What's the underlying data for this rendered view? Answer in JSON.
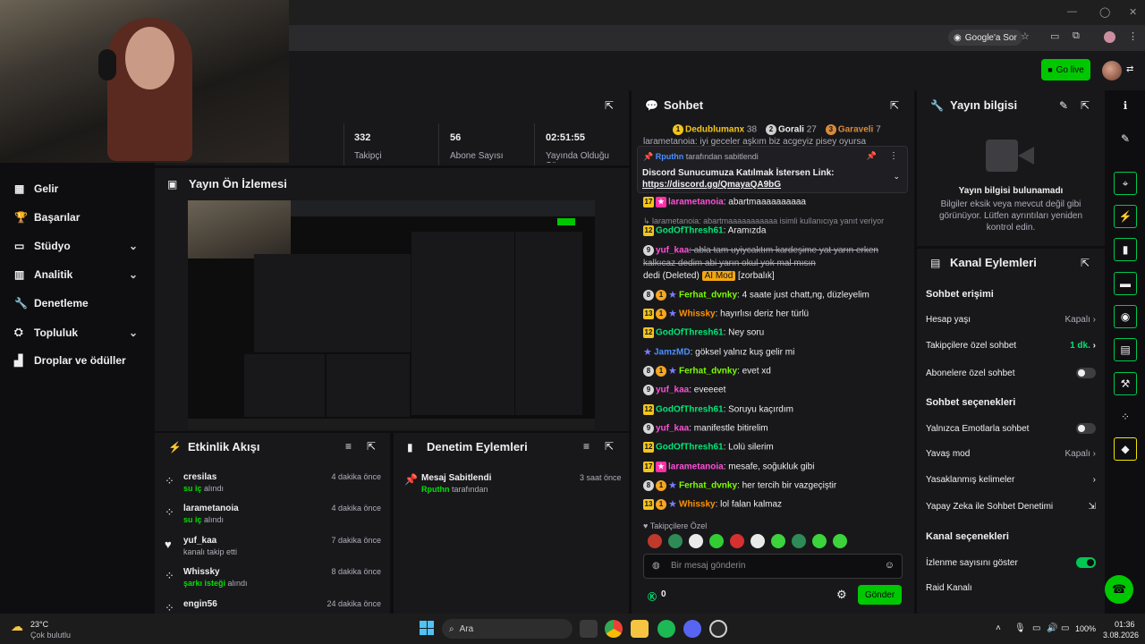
{
  "browser": {
    "google_ask": "Google'a Sor"
  },
  "header": {
    "go_live": "Go live"
  },
  "nav": {
    "items": [
      {
        "label": "Gelir",
        "icon": "dollar-icon",
        "chevron": false
      },
      {
        "label": "Başarılar",
        "icon": "trophy-icon",
        "chevron": false
      },
      {
        "label": "Stüdyo",
        "icon": "studio-icon",
        "chevron": true
      },
      {
        "label": "Analitik",
        "icon": "chart-icon",
        "chevron": true
      },
      {
        "label": "Denetleme",
        "icon": "wrench-icon",
        "chevron": false
      },
      {
        "label": "Topluluk",
        "icon": "community-icon",
        "chevron": true
      },
      {
        "label": "Droplar ve ödüller",
        "icon": "gift-icon",
        "chevron": false
      }
    ]
  },
  "stats": [
    {
      "value": "332",
      "label": "Takipçi"
    },
    {
      "value": "56",
      "label": "Abone Sayısı"
    },
    {
      "value": "02:51:55",
      "label": "Yayında Olduğu Süre"
    }
  ],
  "preview": {
    "title": "Yayın Ön İzlemesi"
  },
  "activity": {
    "title": "Etkinlik Akışı",
    "items": [
      {
        "name": "cresilas",
        "highlight": "su iç",
        "rest": " alındı",
        "time": "4 dakika önce",
        "icon": "points-icon"
      },
      {
        "name": "larametanoia",
        "highlight": "su iç",
        "rest": " alındı",
        "time": "4 dakika önce",
        "icon": "points-icon"
      },
      {
        "name": "yuf_kaa",
        "highlight": "",
        "rest": "kanalı takip etti",
        "time": "7 dakika önce",
        "icon": "heart-icon"
      },
      {
        "name": "Whissky",
        "highlight": "şarkı isteği",
        "rest": " alındı",
        "time": "8 dakika önce",
        "icon": "points-icon"
      },
      {
        "name": "engin56",
        "highlight": "",
        "rest": "",
        "time": "24 dakika önce",
        "icon": "points-icon"
      }
    ]
  },
  "moderation": {
    "title": "Denetim Eylemleri",
    "items": [
      {
        "title": "Mesaj Sabitlendi",
        "user": "Rputhn",
        "rest": " tarafından",
        "time": "3 saat önce"
      }
    ]
  },
  "chat": {
    "title": "Sohbet",
    "leaders": [
      {
        "rank": "1",
        "name": "Dedublumanx",
        "points": "38",
        "color": "#f3c51d"
      },
      {
        "rank": "2",
        "name": "Gorali",
        "points": "27",
        "color": "#cfcfcf"
      },
      {
        "rank": "3",
        "name": "Garaveli",
        "points": "7",
        "color": "#d88a3c"
      }
    ],
    "pinned": {
      "by": "Rputhn",
      "by_suffix": " tarafından sabitlendi",
      "text": "Discord Sunucumuza Katılmak İstersen Link:",
      "link": "https://discord.gg/QmayaQA9bG"
    },
    "hidden_top": "larametanoia: iyi geceler aşkım biz acgeyiz pisey oyursa",
    "reply_note": "larametanoia: abartmaaaaaaaaaaa isimli kullanıcıya yanıt veriyor",
    "messages": [
      {
        "badges": [
          "17",
          "pink"
        ],
        "user": "larametanoia",
        "color": "c-pink",
        "text": ": abartmaaaaaaaaaa"
      },
      {
        "badges": [
          "12"
        ],
        "user": "GodOfThresh61",
        "color": "c-green",
        "text": ": Aramızda"
      },
      {
        "badges": [
          "9c"
        ],
        "user": "yuf_kaa",
        "color": "c-pink",
        "text": ": abla tam uyiycaktım kardeşime yat yarın erken",
        "strike": true
      },
      {
        "badges": [],
        "user": "",
        "color": "",
        "text": "kalkıcaz dedim abi yarın okul yok mal mısın",
        "strike": true
      },
      {
        "badges": [],
        "user": "",
        "color": "",
        "text": "dedi (Deleted) ",
        "ai": "AI Mod",
        "after": " [zorbalık]"
      },
      {
        "badges": [
          "8c",
          "1g",
          "star"
        ],
        "user": "Ferhat_dvnky",
        "color": "c-lime",
        "text": ": 4 saate just chatt,ng, düzleyelim"
      },
      {
        "badges": [
          "13",
          "1g",
          "star"
        ],
        "user": "Whissky",
        "color": "c-orange",
        "text": ": hayırlısı deriz her türlü"
      },
      {
        "badges": [
          "12"
        ],
        "user": "GodOfThresh61",
        "color": "c-green",
        "text": ": Ney soru"
      },
      {
        "badges": [
          "star"
        ],
        "user": "JamzMD",
        "color": "c-blue",
        "text": ": göksel yalnız kuş gelir mi"
      },
      {
        "badges": [
          "8c",
          "1g",
          "star"
        ],
        "user": "Ferhat_dvnky",
        "color": "c-lime",
        "text": ": evet xd"
      },
      {
        "badges": [
          "9c"
        ],
        "user": "yuf_kaa",
        "color": "c-pink",
        "text": ": eveeeet"
      },
      {
        "badges": [
          "12"
        ],
        "user": "GodOfThresh61",
        "color": "c-green",
        "text": ": Soruyu kaçırdım"
      },
      {
        "badges": [
          "9c"
        ],
        "user": "yuf_kaa",
        "color": "c-pink",
        "text": ": manifestle bitirelim"
      },
      {
        "badges": [
          "12"
        ],
        "user": "GodOfThresh61",
        "color": "c-green",
        "text": ": Lolü silerim"
      },
      {
        "badges": [
          "17",
          "pink"
        ],
        "user": "larametanoia",
        "color": "c-pink",
        "text": ": mesafe, soğukluk gibi"
      },
      {
        "badges": [
          "8c",
          "1g",
          "star"
        ],
        "user": "Ferhat_dvnky",
        "color": "c-lime",
        "text": ": her tercih bir vazgeçiştir"
      },
      {
        "badges": [
          "13",
          "1g",
          "star"
        ],
        "user": "Whissky",
        "color": "c-orange",
        "text": ": lol falan kalmaz"
      }
    ],
    "emote_section": "Takipçilere Özel",
    "input_placeholder": "Bir mesaj gönderin",
    "points": "0",
    "send": "Gönder"
  },
  "stream_info": {
    "title": "Yayın bilgisi",
    "empty_title": "Yayın bilgisi bulunamadı",
    "empty_text": "Bilgiler eksik veya mevcut değil gibi görünüyor. Lütfen ayrıntıları yeniden kontrol edin."
  },
  "channel_actions": {
    "title": "Kanal Eylemleri",
    "section1": "Sohbet erişimi",
    "account_age": "Hesap yaşı",
    "account_age_val": "Kapalı",
    "followers_only": "Takipçilere özel sohbet",
    "followers_only_val": "1 dk.",
    "subs_only": "Abonelere özel sohbet",
    "section2": "Sohbet seçenekleri",
    "emote_only": "Yalnızca Emotlarla sohbet",
    "slow_mode": "Yavaş mod",
    "slow_mode_val": "Kapalı",
    "banned_words": "Yasaklanmış kelimeler",
    "ai_mod": "Yapay Zeka ile Sohbet Denetimi",
    "section3": "Kanal seçenekleri",
    "show_viewers": "İzlenme sayısını göster",
    "raid": "Raid Kanalı"
  },
  "taskbar": {
    "weather_temp": "23°C",
    "weather_desc": "Çok bulutlu",
    "search": "Ara",
    "battery": "100%",
    "time": "01:36",
    "date": "3.08.2026"
  }
}
